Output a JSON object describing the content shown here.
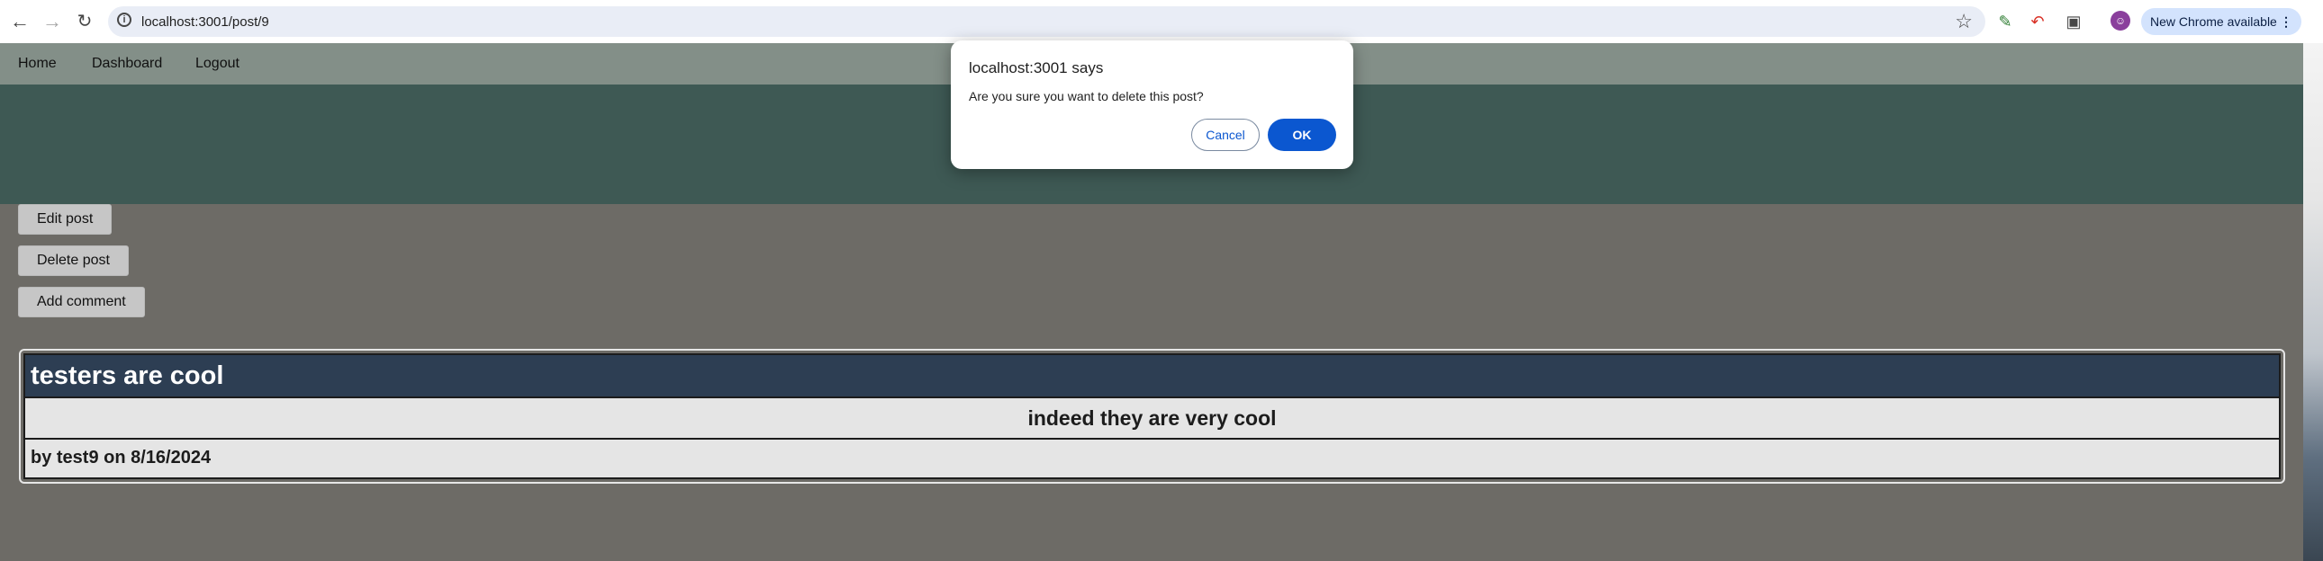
{
  "browser": {
    "url": "localhost:3001/post/9",
    "update_label": "New Chrome available",
    "menu_glyph": "⋮",
    "icons": [
      "back-icon",
      "forward-icon",
      "reload-icon",
      "site-info-icon",
      "bookmark-star-icon",
      "extension-icon",
      "puzzle-icon",
      "profile-icon"
    ]
  },
  "nav": {
    "home": "Home",
    "dashboard": "Dashboard",
    "logout": "Logout"
  },
  "actions": {
    "edit": "Edit post",
    "delete": "Delete post",
    "comment": "Add comment"
  },
  "post": {
    "title": "testers are cool",
    "content": "indeed they are very cool",
    "meta": "by test9 on 8/16/2024"
  },
  "dialog": {
    "title": "localhost:3001 says",
    "message": "Are you sure you want to delete this post?",
    "cancel": "Cancel",
    "ok": "OK"
  },
  "colors": {
    "nav_bg": "#838f88",
    "banner_bg": "#3e5954",
    "page_bg": "#6d6b66",
    "post_title_bg": "#2d3e53",
    "ok_button": "#0b57d0"
  }
}
